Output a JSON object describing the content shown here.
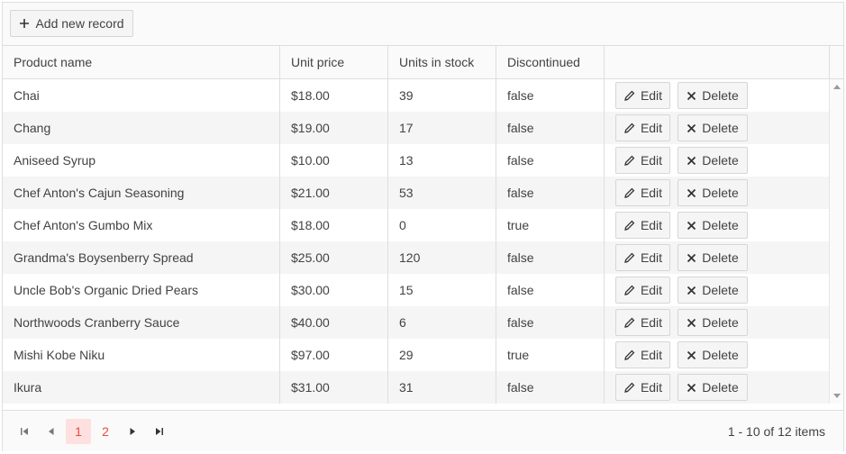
{
  "toolbar": {
    "add_label": "Add new record"
  },
  "columns": [
    "Product name",
    "Unit price",
    "Units in stock",
    "Discontinued",
    ""
  ],
  "actions": {
    "edit_label": "Edit",
    "delete_label": "Delete"
  },
  "rows": [
    {
      "name": "Chai",
      "price": "$18.00",
      "stock": "39",
      "discontinued": "false"
    },
    {
      "name": "Chang",
      "price": "$19.00",
      "stock": "17",
      "discontinued": "false"
    },
    {
      "name": "Aniseed Syrup",
      "price": "$10.00",
      "stock": "13",
      "discontinued": "false"
    },
    {
      "name": "Chef Anton's Cajun Seasoning",
      "price": "$21.00",
      "stock": "53",
      "discontinued": "false"
    },
    {
      "name": "Chef Anton's Gumbo Mix",
      "price": "$18.00",
      "stock": "0",
      "discontinued": "true"
    },
    {
      "name": "Grandma's Boysenberry Spread",
      "price": "$25.00",
      "stock": "120",
      "discontinued": "false"
    },
    {
      "name": "Uncle Bob's Organic Dried Pears",
      "price": "$30.00",
      "stock": "15",
      "discontinued": "false"
    },
    {
      "name": "Northwoods Cranberry Sauce",
      "price": "$40.00",
      "stock": "6",
      "discontinued": "false"
    },
    {
      "name": "Mishi Kobe Niku",
      "price": "$97.00",
      "stock": "29",
      "discontinued": "true"
    },
    {
      "name": "Ikura",
      "price": "$31.00",
      "stock": "31",
      "discontinued": "false"
    }
  ],
  "pager": {
    "pages": [
      "1",
      "2"
    ],
    "current_page": "1",
    "info": "1 - 10 of 12 items"
  },
  "colors": {
    "accent": "#e94a3f",
    "active_page_bg": "#fde0df",
    "alt_row": "#f5f5f5"
  }
}
